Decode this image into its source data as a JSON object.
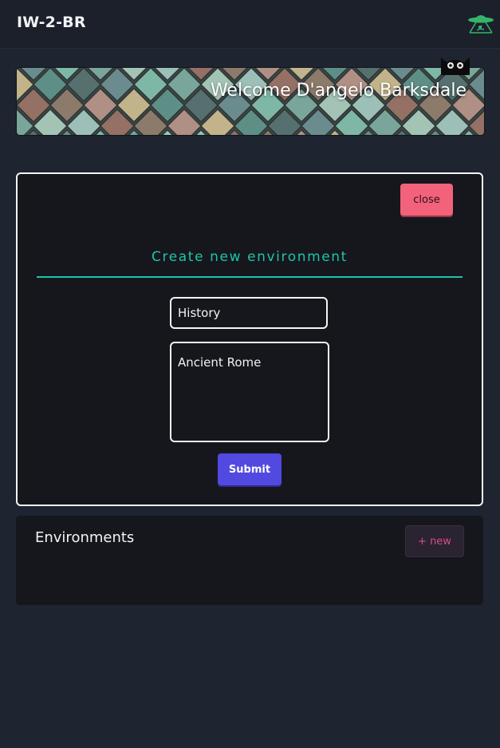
{
  "header": {
    "app_title": "IW-2-BR",
    "logo_icon": "ufo-icon"
  },
  "banner": {
    "welcome_text": "Welcome D'angelo Barksdale",
    "mascot_icon": "black-cat-icon"
  },
  "create_modal": {
    "close_label": "close",
    "title": "Create new environment",
    "name_field": {
      "value": "History"
    },
    "description_field": {
      "value": "Ancient Rome"
    },
    "submit_label": "Submit"
  },
  "environments": {
    "title": "Environments",
    "new_label": "+ new"
  },
  "colors": {
    "page_bg": "#1e2430",
    "panel_bg": "#15171d",
    "accent_teal": "#1fc4a8",
    "close_red": "#f2627a",
    "submit_indigo": "#5149e0",
    "new_pink": "#d3508b"
  }
}
